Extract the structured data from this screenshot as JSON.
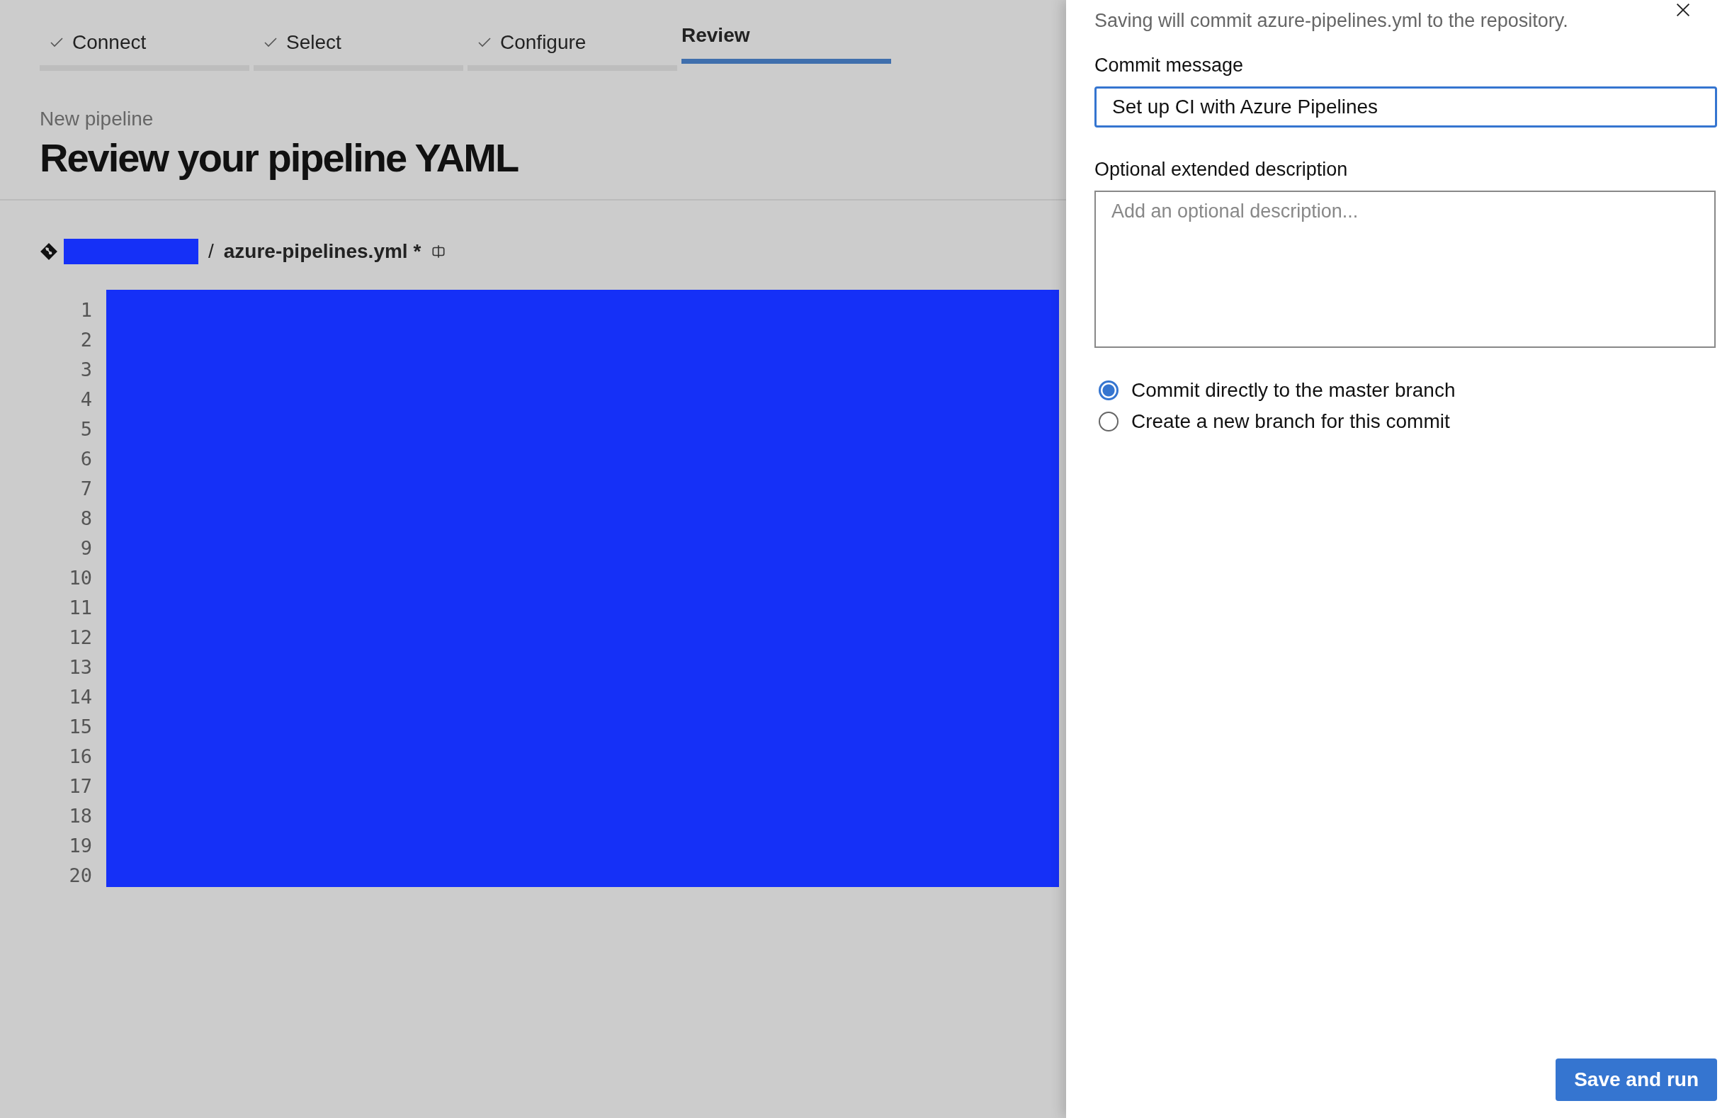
{
  "steps": [
    {
      "label": "Connect",
      "done": true,
      "selected": false
    },
    {
      "label": "Select",
      "done": true,
      "selected": false
    },
    {
      "label": "Configure",
      "done": true,
      "selected": false
    },
    {
      "label": "Review",
      "done": false,
      "selected": true
    }
  ],
  "header": {
    "subtitle": "New pipeline",
    "title": "Review your pipeline YAML"
  },
  "file_path": {
    "separator": "/",
    "file": "azure-pipelines.yml *"
  },
  "editor": {
    "line_numbers": [
      "1",
      "2",
      "3",
      "4",
      "5",
      "6",
      "7",
      "8",
      "9",
      "10",
      "11",
      "12",
      "13",
      "14",
      "15",
      "16",
      "17",
      "18",
      "19",
      "20"
    ]
  },
  "panel": {
    "description": "Saving will commit azure-pipelines.yml to the repository.",
    "commit_message": {
      "label": "Commit message",
      "value": "Set up CI with Azure Pipelines"
    },
    "extended_description": {
      "label": "Optional extended description",
      "placeholder": "Add an optional description..."
    },
    "branch_options": [
      {
        "label": "Commit directly to the master branch",
        "selected": true
      },
      {
        "label": "Create a new branch for this commit",
        "selected": false
      }
    ],
    "primary_button": "Save and run"
  }
}
